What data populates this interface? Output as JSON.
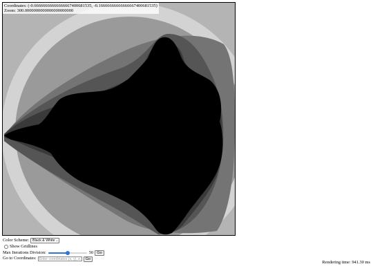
{
  "viewer": {
    "coordinates_label": "Coordinates:",
    "coordinates_value": "(-0.66666666666666667400681535, -0.16666666666666667400681535)",
    "zoom_label": "Zoom:",
    "zoom_value": "300.0000000000000000000000"
  },
  "fractal_colors": {
    "outer": "#b4b4b4",
    "band1": "#d3d3d3",
    "band2": "#9a9a9a",
    "band3": "#747474",
    "band4": "#555555",
    "band5": "#3a3a3a",
    "set": "#000000"
  },
  "controls": {
    "color_scheme_label": "Color Scheme:",
    "color_scheme_selected": "Black & White",
    "gridlines_label": "Show Gridlines",
    "gridlines_checked": false,
    "iterations_label": "Max Iterations Division:",
    "iterations_value": "50",
    "iterations_fraction": 0.5,
    "iterations_button": "Go",
    "goto_label": "Go to Coordinates:",
    "goto_placeholder": "Enter coordinates (x, y), e.g.",
    "goto_button": "Go"
  },
  "status": {
    "render_time": "Rendering time: 941.30 ms"
  }
}
